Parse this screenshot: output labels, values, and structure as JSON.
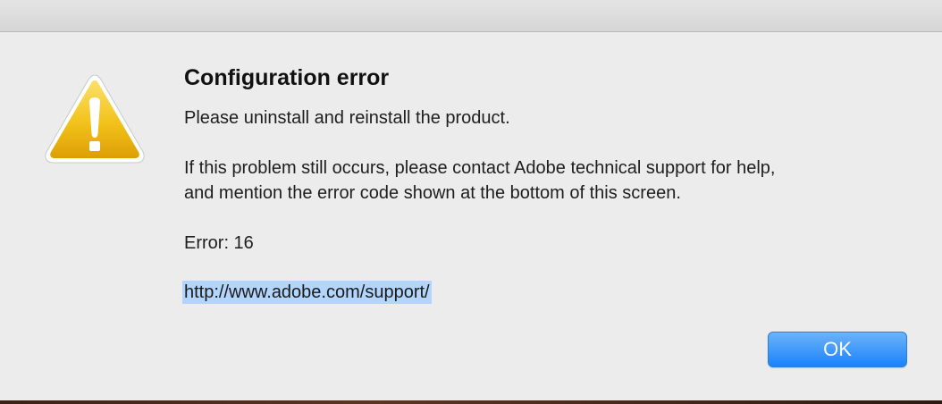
{
  "dialog": {
    "title": "Configuration error",
    "message_1": "Please uninstall and reinstall the product.",
    "message_2_line_1": "If this problem still occurs, please contact Adobe technical support for help,",
    "message_2_line_2": "and mention the error code shown at the bottom of this screen.",
    "error_code": "Error: 16",
    "support_link": "http://www.adobe.com/support/",
    "ok_label": "OK",
    "icon": "warning-icon"
  },
  "colors": {
    "background": "#ececec",
    "accent_button": "#1a82fb",
    "link_highlight": "#b3d5fb",
    "warning_yellow": "#f2b90f"
  }
}
